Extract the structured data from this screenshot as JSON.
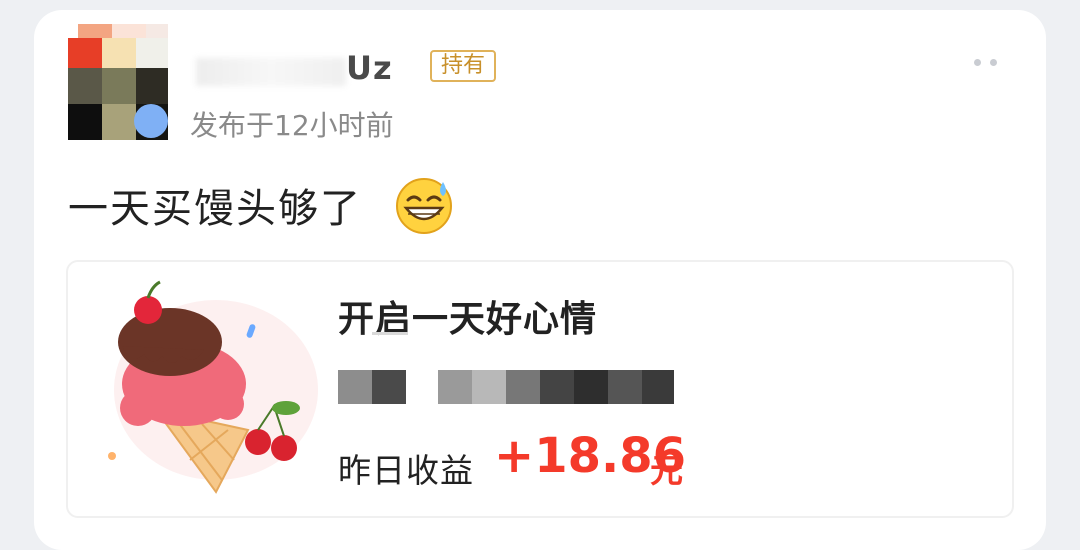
{
  "post": {
    "username_visible": "Uz",
    "holding_badge": "持有",
    "time": "发布于12小时前",
    "text": "一天买馒头够了",
    "emoji": "grinning-sweat"
  },
  "share_card": {
    "title": "开启一天好心情",
    "earnings_label": "昨日收益",
    "earnings_value": "+18.86",
    "earnings_unit": "元"
  },
  "colors": {
    "accent_red": "#f43a2a",
    "badge_gold": "#c8902a",
    "muted_text": "#8a8a8a"
  }
}
